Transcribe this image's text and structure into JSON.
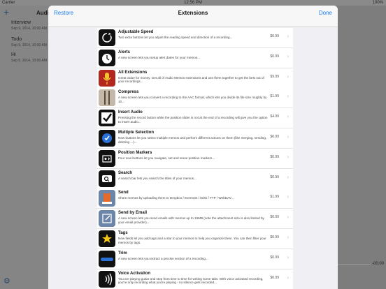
{
  "status": {
    "carrier": "Carrier",
    "time": "12:56 PM",
    "battery": "100%"
  },
  "background": {
    "sidebar_title": "Audio Memos",
    "items": [
      {
        "title": "Interview",
        "subtitle": "Sep 9, 2014, 10:00 AM"
      },
      {
        "title": "Todo",
        "subtitle": "Sep 9, 2014, 10:00 AM"
      },
      {
        "title": "Hi",
        "subtitle": "Sep 9, 2014, 10:00 AM"
      }
    ],
    "elapsed": "-00:00"
  },
  "modal": {
    "restore_label": "Restore",
    "title": "Extensions",
    "done_label": "Done",
    "items": [
      {
        "name": "Adjustable Speed",
        "desc": "Two extra buttons let you adjust the reading speed and direction of a recording...",
        "price": "$0.99",
        "icon": "speed-icon",
        "color": "#111111"
      },
      {
        "name": "Alerts",
        "desc": "A new screen lets you setup alert dates for your memos...",
        "price": "$0.99",
        "icon": "alarm-clock-icon",
        "color": "#111111"
      },
      {
        "name": "All Extensions",
        "desc": "Great value for money. Get all of Audio Memos extensions and use them together to get the best out of your recordings...",
        "price": "$9.99",
        "icon": "microphone-icon",
        "color": "#b3261e"
      },
      {
        "name": "Compress",
        "desc": "A new screen lets you convert a recording to the AAC format, which lets you divide its file size roughly by 10...",
        "price": "$1.99",
        "icon": "compress-icon",
        "color": "#6e5a4a"
      },
      {
        "name": "Insert Audio",
        "desc": "Pressing the record button while the position slider is not at the end of a recording will give you the option to insert audio...",
        "price": "$4.99",
        "icon": "checkbox-icon",
        "color": "#111111"
      },
      {
        "name": "Multiple Selection",
        "desc": "New buttons let you select multiple memos and perform different actions on them (like merging, sending, deleting ...)...",
        "price": "$0.99",
        "icon": "multi-select-icon",
        "color": "#1a3b6e"
      },
      {
        "name": "Position Markers",
        "desc": "Four new buttons let you navigate, set and erase position markers...",
        "price": "$0.99",
        "icon": "marker-icon",
        "color": "#111111"
      },
      {
        "name": "Search",
        "desc": "A search bar lets you search the titles of your memos...",
        "price": "$0.99",
        "icon": "search-icon",
        "color": "#111111"
      },
      {
        "name": "Send",
        "desc": "Share memos by uploading them to Dropbox / Evernote / iDisk / FTP / WebDAV...",
        "price": "$1.99",
        "icon": "send-icon",
        "color": "#6b86a8"
      },
      {
        "name": "Send by Email",
        "desc": "A new screen lets you send emails with memos up to 15MB (note the attachment size is also limited by your email provider)...",
        "price": "$0.99",
        "icon": "email-icon",
        "color": "#6b86a8"
      },
      {
        "name": "Tags",
        "desc": "New fields let you add tags and a star to your memos to help you organize them. You can then filter your memos by tags.",
        "price": "$0.99",
        "icon": "star-icon",
        "color": "#111111"
      },
      {
        "name": "Trim",
        "desc": "A new screen lets you extract a precise section of a recording...",
        "price": "$0.99",
        "icon": "trim-icon",
        "color": "#111111"
      },
      {
        "name": "Voice Activation",
        "desc": "You are playing guitar and stop from time to time for writing some tabs. With voice activated recording, you're only recording what you're playing - no silence gets recorded...",
        "price": "$0.99",
        "icon": "voice-waves-icon",
        "color": "#111111"
      }
    ]
  }
}
